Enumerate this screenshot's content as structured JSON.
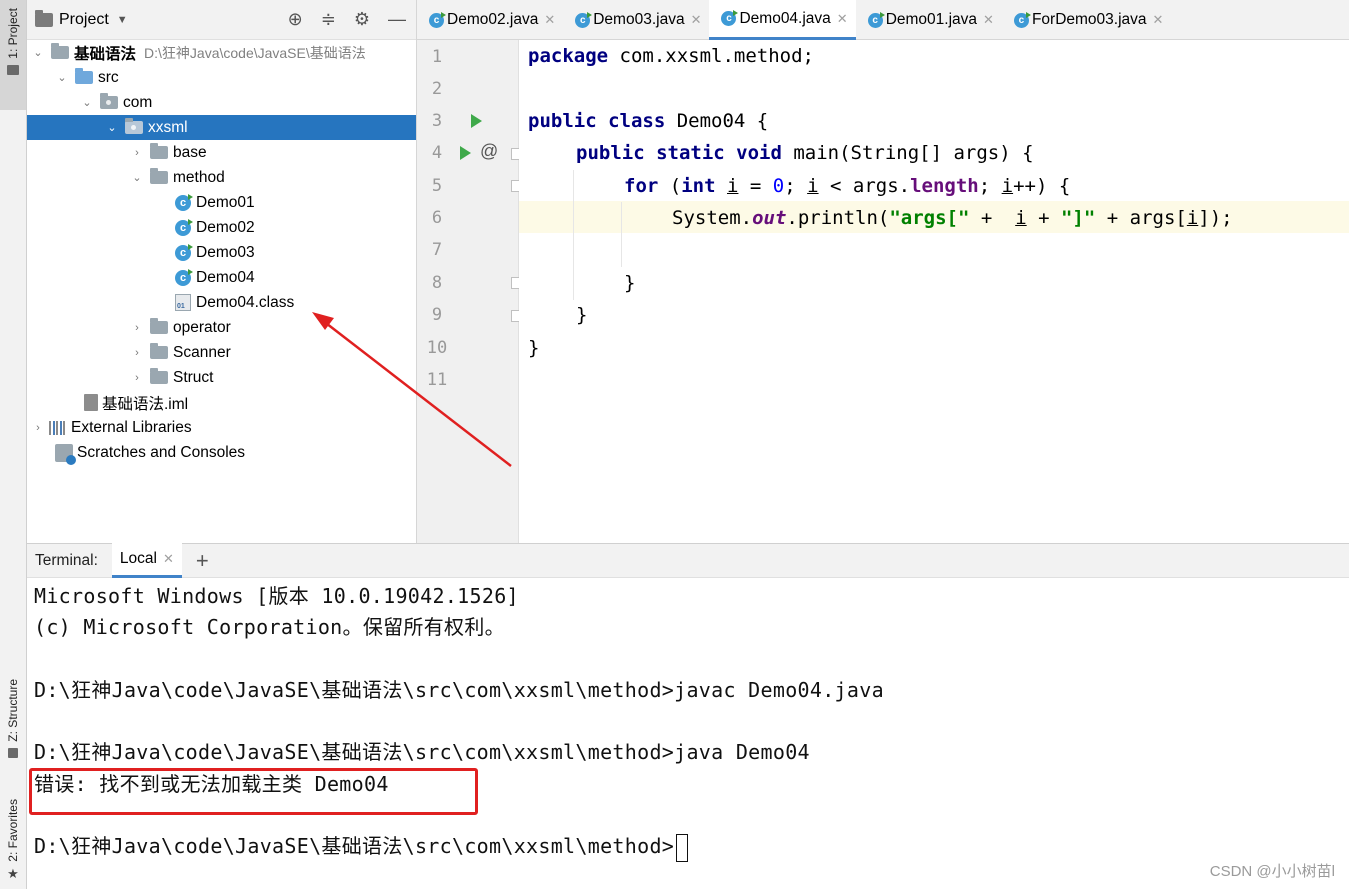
{
  "left_strip": {
    "project_tab": "1: Project",
    "structure_tab": "Z: Structure",
    "favorites_tab": "2: Favorites"
  },
  "project_panel": {
    "title": "Project",
    "tree": [
      {
        "label": "基础语法",
        "path": "D:\\狂神Java\\code\\JavaSE\\基础语法"
      },
      {
        "label": "src"
      },
      {
        "label": "com"
      },
      {
        "label": "xxsml"
      },
      {
        "label": "base"
      },
      {
        "label": "method"
      },
      {
        "label": "Demo01"
      },
      {
        "label": "Demo02"
      },
      {
        "label": "Demo03"
      },
      {
        "label": "Demo04"
      },
      {
        "label": "Demo04.class"
      },
      {
        "label": "operator"
      },
      {
        "label": "Scanner"
      },
      {
        "label": "Struct"
      },
      {
        "label": "基础语法.iml"
      },
      {
        "label": "External Libraries"
      },
      {
        "label": "Scratches and Consoles"
      }
    ],
    "class_file_badge": "01"
  },
  "editor_tabs": [
    {
      "label": "Demo02.java",
      "active": false
    },
    {
      "label": "Demo03.java",
      "active": false
    },
    {
      "label": "Demo04.java",
      "active": true
    },
    {
      "label": "Demo01.java",
      "active": false
    },
    {
      "label": "ForDemo03.java",
      "active": false
    }
  ],
  "editor": {
    "line_numbers": [
      "1",
      "2",
      "3",
      "4",
      "5",
      "6",
      "7",
      "8",
      "9",
      "10",
      "11"
    ],
    "code": {
      "l1_kw": "package",
      "l1_rest": " com.xxsml.method;",
      "l3_kw": "public class",
      "l3_rest": " Demo04 {",
      "l4_kw": "public static void",
      "l4_rest": " main(String[] args) {",
      "l5_for": "for",
      "l5_a": " (",
      "l5_int": "int",
      "l5_b": " ",
      "l5_i1": "i",
      "l5_c": " = ",
      "l5_zero": "0",
      "l5_d": "; ",
      "l5_i2": "i",
      "l5_e": " < args.",
      "l5_length": "length",
      "l5_f": "; ",
      "l5_i3": "i",
      "l5_g": "++) {",
      "l6_a": "System.",
      "l6_out": "out",
      "l6_b": ".println(",
      "l6_s1": "\"args[\"",
      "l6_c": " +  ",
      "l6_i1": "i",
      "l6_d": " + ",
      "l6_s2": "\"]\"",
      "l6_e": " + args[",
      "l6_i2": "i",
      "l6_f": "]);",
      "l8": "}",
      "l9": "}",
      "l10": "}"
    }
  },
  "terminal": {
    "label": "Terminal:",
    "tab": "Local",
    "lines": [
      "Microsoft Windows [版本 10.0.19042.1526]",
      "(c) Microsoft Corporation。保留所有权利。",
      "",
      "D:\\狂神Java\\code\\JavaSE\\基础语法\\src\\com\\xxsml\\method>javac Demo04.java",
      "",
      "D:\\狂神Java\\code\\JavaSE\\基础语法\\src\\com\\xxsml\\method>java Demo04",
      "错误: 找不到或无法加载主类 Demo04",
      "",
      "D:\\狂神Java\\code\\JavaSE\\基础语法\\src\\com\\xxsml\\method>"
    ]
  },
  "watermark": "CSDN @小小树苗l",
  "colors": {
    "selection": "#2675bf",
    "annotation_red": "#e02020",
    "keyword": "#000080",
    "string": "#008000"
  }
}
